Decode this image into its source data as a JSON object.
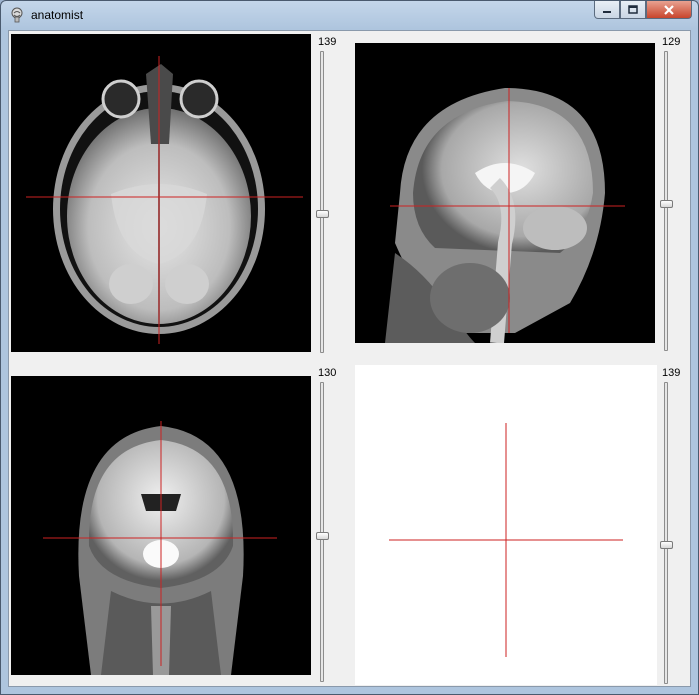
{
  "window": {
    "title": "anatomist",
    "app_icon": "anatomist-app-icon",
    "buttons": [
      "minimize",
      "maximize",
      "close"
    ]
  },
  "views": {
    "axial": {
      "slice": "139",
      "image": "axial brain MRI slice"
    },
    "sagittal": {
      "slice": "129",
      "image": "sagittal brain MRI slice"
    },
    "coronal": {
      "slice": "130",
      "image": "coronal brain MRI slice"
    },
    "empty": {
      "slice": "139"
    }
  },
  "colors": {
    "cursor": "#cc2222",
    "view_background": "#000000",
    "empty_view_background": "#ffffff"
  }
}
